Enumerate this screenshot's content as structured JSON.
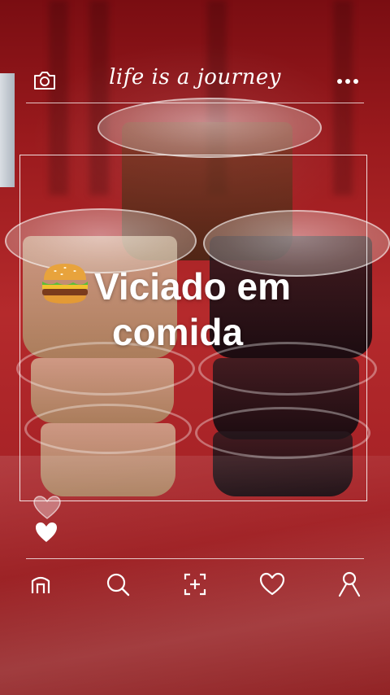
{
  "header": {
    "title": "life is a journey",
    "camera_icon": "camera-icon",
    "more_icon": "more-horizontal-icon"
  },
  "post": {
    "caption_emoji": "burger-icon",
    "caption_line1": "Viciado em",
    "caption_line2": "comida"
  },
  "reactions": {
    "like_outline_icon": "heart-outline-icon",
    "like_filled_icon": "heart-filled-icon"
  },
  "bottom_nav": {
    "items": [
      {
        "icon": "home-icon"
      },
      {
        "icon": "search-icon"
      },
      {
        "icon": "add-post-icon"
      },
      {
        "icon": "heart-icon"
      },
      {
        "icon": "profile-icon"
      }
    ]
  },
  "colors": {
    "overlay": "#ffffff",
    "background": "#a62226"
  }
}
